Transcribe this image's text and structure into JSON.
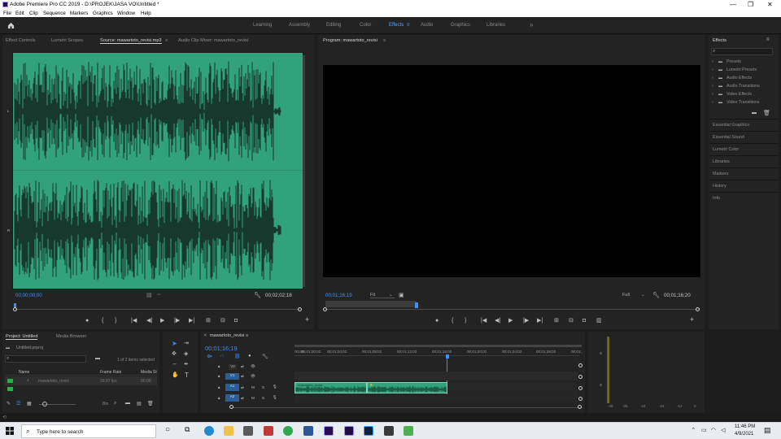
{
  "title_bar": {
    "title": "Adobe Premiere Pro CC 2019 - D:\\PROJEK\\JASA VO\\Untitled *",
    "min": "—",
    "max": "❐",
    "close": "✕"
  },
  "menu": [
    "File",
    "Edit",
    "Clip",
    "Sequence",
    "Markers",
    "Graphics",
    "Window",
    "Help"
  ],
  "workspaces": {
    "items": [
      "Learning",
      "Assembly",
      "Editing",
      "Color",
      "Effects",
      "Audio",
      "Graphics",
      "Libraries"
    ],
    "active": "Effects",
    "more": "»",
    "menu_glyph": "≡"
  },
  "source_panel": {
    "tabs": [
      "Effect Controls",
      "Lumetri Scopes",
      "Source: mawartoto_revisi.mp3",
      "Audio Clip Mixer: mawartoto_revisi"
    ],
    "active_tab": "Source: mawartoto_revisi.mp3",
    "timecode_in": "00;00;00;00",
    "timecode_duration": "00;02;02;18",
    "channel_labels": [
      "L",
      "R"
    ],
    "waveform_color": "#2ea078",
    "waveform_bg": "#32a27c"
  },
  "program_panel": {
    "tab": "Program: mawartoto_revisi",
    "timecode": "00;01;16;19",
    "fit": "Fit",
    "resolution": "Full",
    "duration": "00;01;16;20"
  },
  "effects_panel": {
    "title": "Effects",
    "items": [
      "Presets",
      "Lumetri Presets",
      "Audio Effects",
      "Audio Transitions",
      "Video Effects",
      "Video Transitions"
    ],
    "sections": [
      "Essential Graphics",
      "Essential Sound",
      "Lumetri Color",
      "Libraries",
      "Markers",
      "History",
      "Info"
    ]
  },
  "project_panel": {
    "tabs": [
      "Project: Untitled",
      "Media Browser"
    ],
    "project_file": "Untitled.prproj",
    "items_selected": "1 of 2 items selected",
    "columns": [
      "Name",
      "Frame Rate",
      "Media St"
    ],
    "rows": [
      {
        "name": "mawartoto_revisi",
        "frame_rate": "29,97 fps",
        "media_start": "00;00"
      }
    ],
    "bin_label": "Bin"
  },
  "timeline": {
    "sequence_tab": "mawartoto_revisi",
    "timecode": "00;01;16;19",
    "ruler": [
      "00;00",
      "00;01;00;02",
      "00;01;04;02",
      "00;01;08;02",
      "00;01;12;02",
      "00;01;16;02",
      "00;01;20;02",
      "00;01;24;02",
      "00;01;28;02",
      "00;01;"
    ],
    "tracks": [
      "V2",
      "V1",
      "A1",
      "A2"
    ],
    "clip_label": "mawartoto_revisi",
    "track_toggles": [
      "M",
      "S"
    ]
  },
  "audio_meter": {
    "scale": [
      "-48",
      "-36",
      "-24",
      "-12",
      "0"
    ],
    "side_labels": [
      "S",
      "S"
    ]
  },
  "taskbar": {
    "search_placeholder": "Type here to search",
    "time": "11:46 PM",
    "date": "4/9/2021"
  }
}
